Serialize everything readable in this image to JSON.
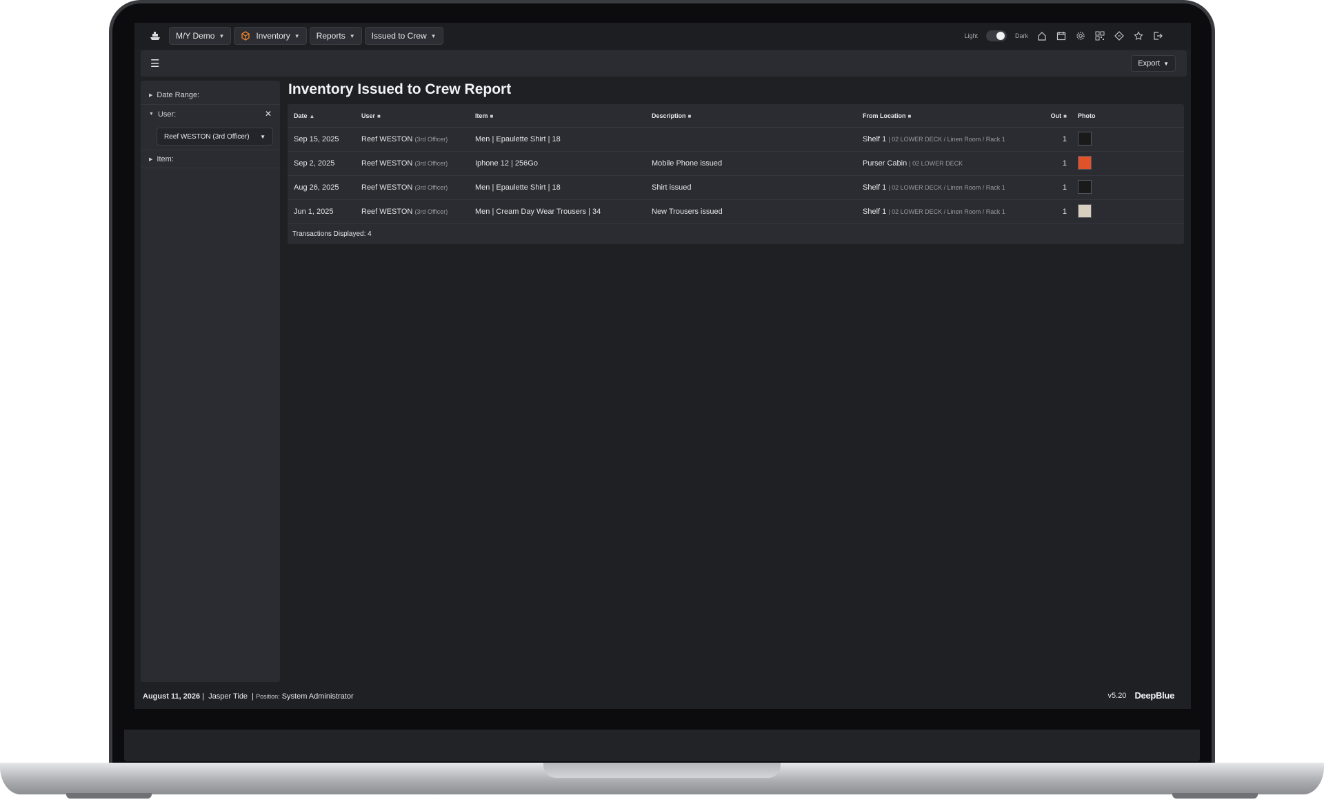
{
  "nav": {
    "vessel": "M/Y Demo",
    "module": "Inventory",
    "reports": "Reports",
    "report_name": "Issued to Crew"
  },
  "theme": {
    "light_label": "Light",
    "dark_label": "Dark"
  },
  "toolbar": {
    "export_label": "Export"
  },
  "filters": {
    "date_range": "Date Range:",
    "user": "User:",
    "user_value": "Reef WESTON (3rd Officer)",
    "item": "Item:"
  },
  "page": {
    "title": "Inventory Issued to Crew Report"
  },
  "table": {
    "headers": {
      "date": "Date",
      "user": "User",
      "item": "Item",
      "description": "Description",
      "from_location": "From Location",
      "out": "Out",
      "photo": "Photo"
    },
    "rows": [
      {
        "date": "Sep 15, 2025",
        "user": "Reef WESTON",
        "user_role": "(3rd Officer)",
        "item": "Men | Epaulette Shirt | 18",
        "description": "",
        "loc_main": "Shelf 1",
        "loc_sub": "| 02 LOWER DECK / Linen Room / Rack 1",
        "out": "1",
        "photo_color": "#1a1a1a"
      },
      {
        "date": "Sep 2, 2025",
        "user": "Reef WESTON",
        "user_role": "(3rd Officer)",
        "item": "Iphone 12 | 256Go",
        "description": "Mobile Phone issued",
        "loc_main": "Purser Cabin",
        "loc_sub": "| 02 LOWER DECK",
        "out": "1",
        "photo_color": "#e0532a"
      },
      {
        "date": "Aug 26, 2025",
        "user": "Reef WESTON",
        "user_role": "(3rd Officer)",
        "item": "Men | Epaulette Shirt | 18",
        "description": "Shirt issued",
        "loc_main": "Shelf 1",
        "loc_sub": "| 02 LOWER DECK / Linen Room / Rack 1",
        "out": "1",
        "photo_color": "#1a1a1a"
      },
      {
        "date": "Jun 1, 2025",
        "user": "Reef WESTON",
        "user_role": "(3rd Officer)",
        "item": "Men | Cream Day Wear Trousers | 34",
        "description": "New Trousers issued",
        "loc_main": "Shelf 1",
        "loc_sub": "| 02 LOWER DECK / Linen Room / Rack 1",
        "out": "1",
        "photo_color": "#d9cfc0"
      }
    ],
    "footer": "Transactions Displayed: 4"
  },
  "footer": {
    "date": "August 11, 2026",
    "user": "Jasper Tide",
    "position_label": "Position:",
    "position": "System Administrator",
    "version": "v5.20",
    "brand": "DeepBlue"
  },
  "colors": {
    "accent": "#e8812b",
    "background": "#1f2024",
    "panel": "#2a2c31"
  }
}
